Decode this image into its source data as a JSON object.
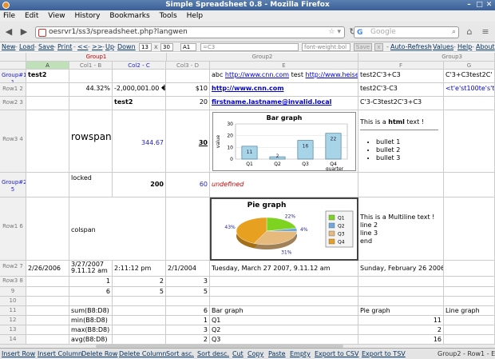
{
  "window": {
    "title": "Simple Spreadsheet 0.8 - Mozilla Firefox"
  },
  "menu": [
    "File",
    "Edit",
    "View",
    "History",
    "Bookmarks",
    "Tools",
    "Help"
  ],
  "nav": {
    "url": "oesrvr1/ss3/spreadsheet.php?langwen",
    "search_placeholder": "Google"
  },
  "toolbar": {
    "links": [
      "New",
      "Load",
      "Save",
      "Print",
      "<<",
      ">>",
      "Up",
      "Down"
    ],
    "row_value": "13",
    "x": "x",
    "col_value": "30",
    "cell_ref": "A1",
    "formula_placeholder": "=C3",
    "style_placeholder": "font-weight:bol",
    "save_btn": "Save",
    "close_btn": "x",
    "right_links": [
      "Auto-Refresh",
      "Values",
      "Help",
      "About"
    ]
  },
  "groups": {
    "g1": "Group1",
    "g2": "Group2",
    "g3": "Group3"
  },
  "columns": {
    "a": "A",
    "b": "Col1 - B",
    "c": "Col2 - C",
    "d": "Col3 - D",
    "e": "E",
    "f": "F",
    "g": "G"
  },
  "rows": {
    "r1": "Group#1 1",
    "r2": "Row1 2",
    "r3": "Row2 3",
    "r4": "Row3 4",
    "r5": "Group#2 5",
    "r6": "Row1 6",
    "r7": "Row2 7",
    "r8": "Row3 8",
    "r9": "9",
    "r10": "10",
    "r11": "11",
    "r12": "12",
    "r13": "13",
    "r14": "14"
  },
  "cells": {
    "a1": "test2",
    "e1_pre": "abc ",
    "e1_link1": "http://www.cnn.com",
    "e1_mid": " test ",
    "e1_link2": "http://www.heise.de",
    "f1": "test2C'3+C3",
    "g1": "C'3+C3test2C'",
    "b2": "44.32%",
    "c2": "-2,000,001.00 �",
    "d2": "$10",
    "e2": "http://www.cnn.com",
    "f2": "test2C'3-C3",
    "g2": "<t'e'st100te's't",
    "c3": "test2",
    "d3": "20",
    "e3": "firstname.lastname@invalid.local",
    "f3": "C'3-C3test2C'3+C3",
    "b4": "rowspan",
    "c4": "344.67",
    "d4": "30",
    "f4_pre": "This is a ",
    "f4_bold": "html",
    "f4_post": " text !",
    "bullets": [
      "bullet 1",
      "bullet 2",
      "bullet 3"
    ],
    "b5": "locked",
    "c5": "200",
    "d5": "60",
    "e5": "undefined",
    "b6": "colspan",
    "f6": [
      "This is a Multiline text !",
      "line 2",
      "line 3",
      "end"
    ],
    "a7": "2/26/2006",
    "b7": "3/27/2007 9.11.12 am",
    "c7": "2:11:12 pm",
    "d7": "2/1/2004",
    "e7": "Tuesday, March 27 2007, 9.11.12 am",
    "f7": "Sunday, February 26 2006",
    "b8": "1",
    "c8": "2",
    "d8": "3",
    "b9": "6",
    "c9": "5",
    "d9": "5",
    "b11": "sum(B8:D8)",
    "d11": "6",
    "e11": "Bar graph",
    "f11": "Pie graph",
    "g11": "Line graph",
    "b12": "min(B8:D8)",
    "d12": "1",
    "e12": "Q1",
    "f12": "11",
    "b13": "max(B8:D8)",
    "d13": "3",
    "e13": "Q2",
    "f13": "2",
    "b14": "avg(B8:D8)",
    "d14": "2",
    "e14": "Q3",
    "f14": "16"
  },
  "bottom": {
    "links": [
      "Insert Row",
      "Insert Column",
      "Delete Row",
      "Delete Column",
      "Sort asc.",
      "Sort desc.",
      "Cut",
      "Copy",
      "Paste",
      "Empty",
      "Export to CSV",
      "Export to TSV"
    ],
    "status": "Group2 - Row1 - E6"
  },
  "chart_data": [
    {
      "type": "bar",
      "title": "Bar graph",
      "categories": [
        "Q1",
        "Q2",
        "Q3",
        "Q4"
      ],
      "values": [
        11,
        2,
        16,
        22
      ],
      "xlabel": "quarter",
      "ylabel": "value",
      "ylim": [
        0,
        30
      ],
      "yticks": [
        0,
        10,
        20,
        30
      ],
      "color": "#a8d4e8"
    },
    {
      "type": "pie",
      "title": "Pie graph",
      "categories": [
        "Q1",
        "Q2",
        "Q3",
        "Q4"
      ],
      "values": [
        11,
        2,
        16,
        22
      ],
      "labels": [
        "22%",
        "4%",
        "31%",
        "43%"
      ],
      "colors": [
        "#7ed321",
        "#6fa8dc",
        "#e6b97d",
        "#e8a020"
      ],
      "legend": "right"
    }
  ]
}
